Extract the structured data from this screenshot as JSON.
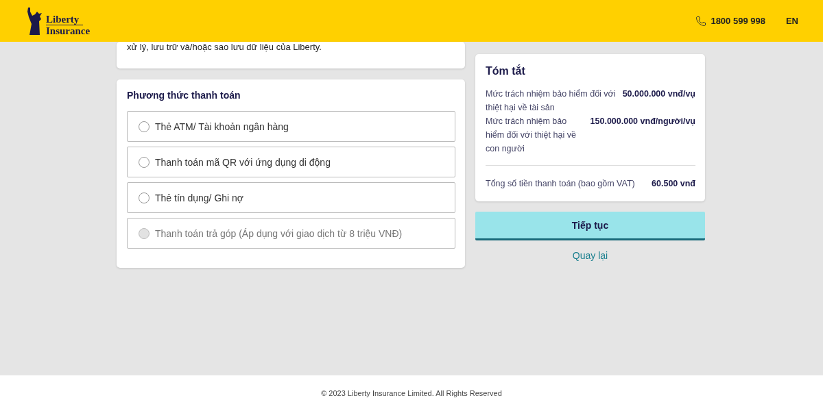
{
  "header": {
    "logo": {
      "line1": "Liberty",
      "line2": "Insurance"
    },
    "phone": "1800 599 998",
    "language": "EN"
  },
  "consent_card": {
    "text": "xử lý, lưu trữ và/hoặc sao lưu dữ liệu của Liberty."
  },
  "payment": {
    "title": "Phương thức thanh toán",
    "options": [
      {
        "label": "Thẻ ATM/ Tài khoản ngân hàng",
        "selected": false,
        "disabled": false
      },
      {
        "label": "Thanh toán mã QR với ứng dụng di động",
        "selected": false,
        "disabled": false
      },
      {
        "label": "Thẻ tín dụng/ Ghi nợ",
        "selected": false,
        "disabled": false
      },
      {
        "label": "Thanh toán trả góp (Áp dụng với giao dịch từ 8 triệu VNĐ)",
        "selected": false,
        "disabled": true
      }
    ]
  },
  "summary": {
    "title": "Tóm tắt",
    "rows": [
      {
        "label": "Mức trách nhiệm bảo hiểm đối với thiệt hại về tài sản",
        "value": "50.000.000 vnđ/vụ"
      },
      {
        "label": "Mức trách nhiệm bảo hiểm đối với thiệt hại về con người",
        "value": "150.000.000 vnđ/người/vụ"
      }
    ],
    "total": {
      "label": "Tổng số tiền thanh toán (bao gồm VAT)",
      "value": "60.500 vnđ"
    }
  },
  "continue_button": "Tiếp tục",
  "back_link": "Quay lại",
  "footer": "© 2023 Liberty Insurance Limited. All Rights Reserved"
}
